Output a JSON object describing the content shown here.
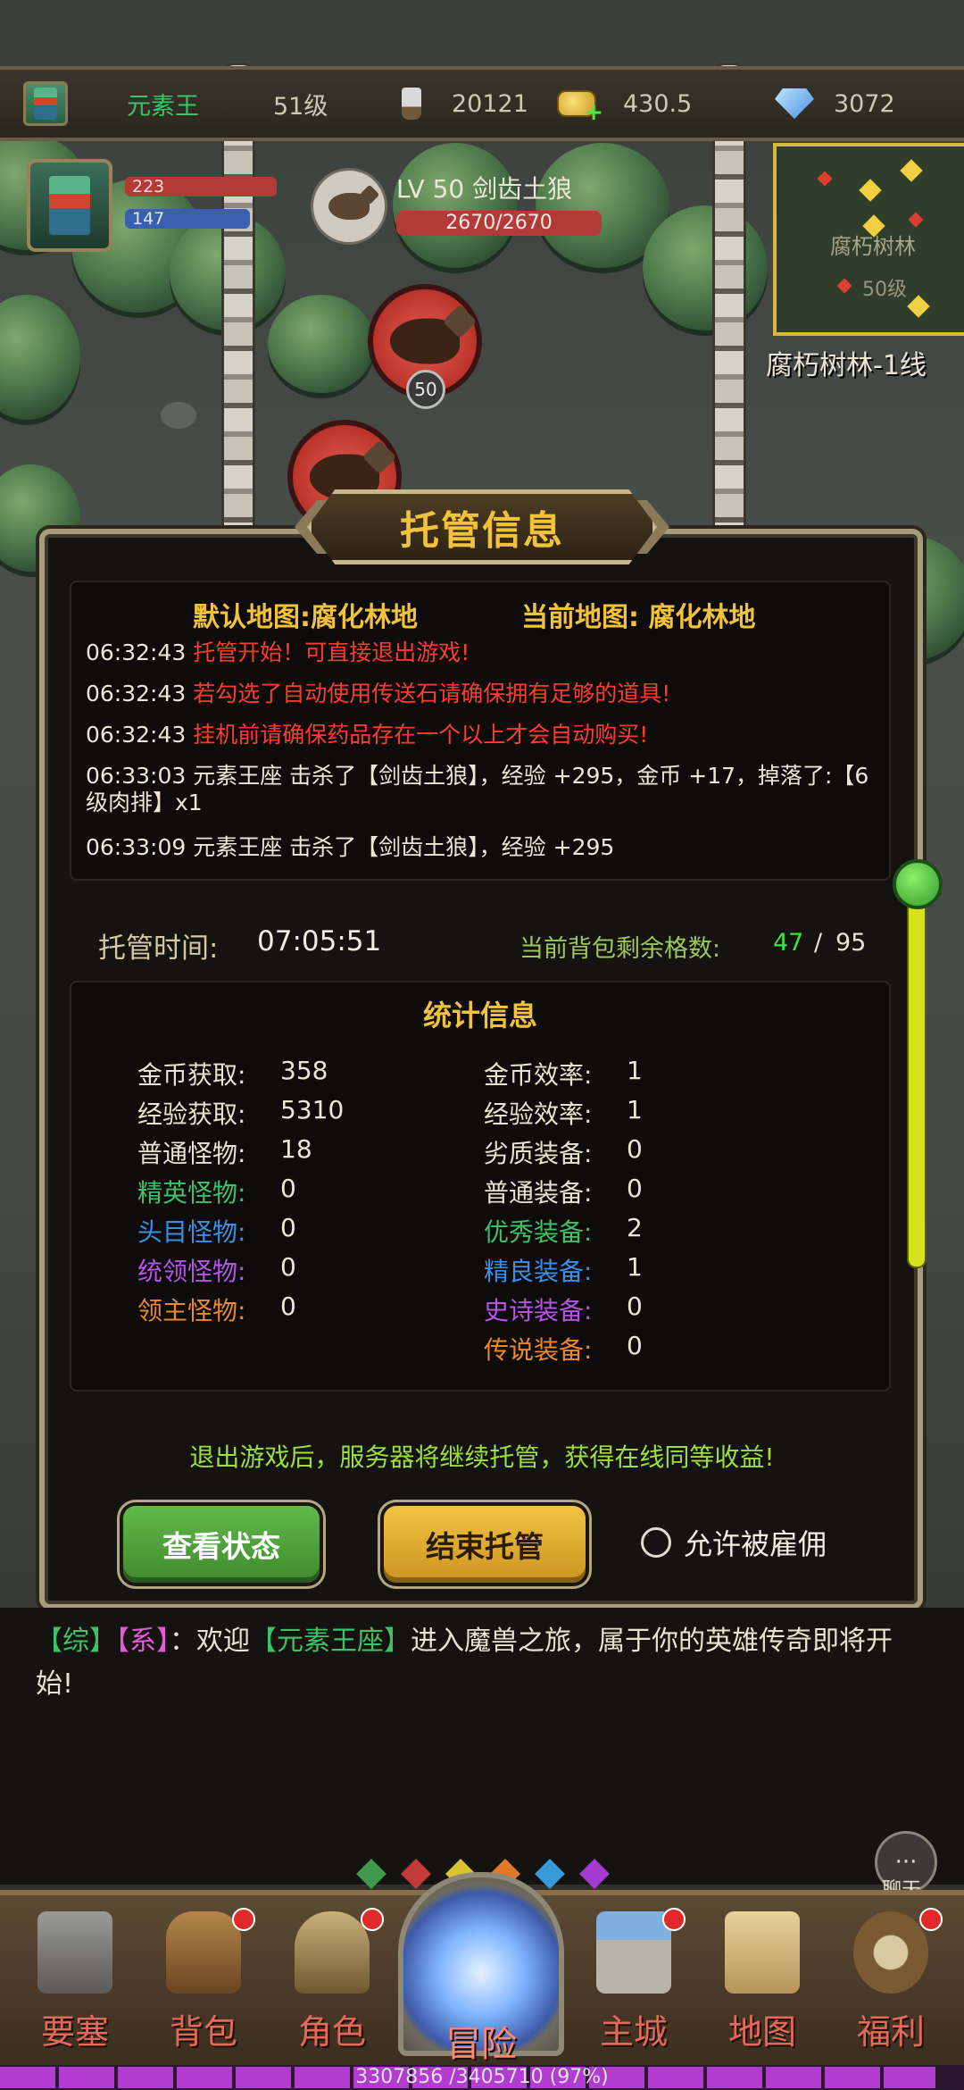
{
  "top_bar": {
    "player_name": "元素王",
    "level": "51级",
    "power": "20121",
    "gold": "430.5",
    "diamonds": "3072"
  },
  "hero": {
    "hp_text": "223",
    "mp_text": "147"
  },
  "target": {
    "name": "LV 50 剑齿土狼",
    "hp": "2670/2670"
  },
  "enemy_level_badge": "50",
  "minimap": {
    "area_name": "腐朽树林",
    "level": "50级",
    "line_label": "腐朽树林-1线"
  },
  "modal": {
    "title": "托管信息",
    "default_map_label": "默认地图:腐化林地",
    "current_map_label": "当前地图: 腐化林地",
    "log": [
      {
        "time": "06:32:43",
        "text": "托管开始！可直接退出游戏!",
        "color": "red"
      },
      {
        "time": "06:32:43",
        "text": "若勾选了自动使用传送石请确保拥有足够的道具!",
        "color": "red"
      },
      {
        "time": "06:32:43",
        "text": "挂机前请确保药品存在一个以上才会自动购买!",
        "color": "red"
      },
      {
        "time": "06:33:03",
        "text": "元素王座 击杀了【剑齿土狼】，经验 +295，金币 +17，掉落了:【6级肉排】x1",
        "color": "white"
      },
      {
        "time": "06:33:09",
        "text": "元素王座 击杀了【剑齿土狼】，经验 +295",
        "color": "white"
      }
    ],
    "hosting_time_label": "托管时间:",
    "hosting_time": "07:05:51",
    "bag_label": "当前背包剩余格数:",
    "bag_current": "47",
    "bag_sep": "/",
    "bag_max": "95",
    "stats_title": "统计信息",
    "stats_left": [
      {
        "label": "金币获取:",
        "value": "358",
        "color": "#e8e2d0"
      },
      {
        "label": "经验获取:",
        "value": "5310",
        "color": "#e8e2d0"
      },
      {
        "label": "普通怪物:",
        "value": "18",
        "color": "#e8e2d0"
      },
      {
        "label": "精英怪物:",
        "value": "0",
        "color": "#3ec267"
      },
      {
        "label": "头目怪物:",
        "value": "0",
        "color": "#3a8fe6"
      },
      {
        "label": "统领怪物:",
        "value": "0",
        "color": "#b454e6"
      },
      {
        "label": "领主怪物:",
        "value": "0",
        "color": "#e88a2a"
      }
    ],
    "stats_right": [
      {
        "label": "金币效率:",
        "value": "1",
        "color": "#e8e2d0"
      },
      {
        "label": "经验效率:",
        "value": "1",
        "color": "#e8e2d0"
      },
      {
        "label": "劣质装备:",
        "value": "0",
        "color": "#e8e2d0"
      },
      {
        "label": "普通装备:",
        "value": "0",
        "color": "#e8e2d0"
      },
      {
        "label": "优秀装备:",
        "value": "2",
        "color": "#3ec267"
      },
      {
        "label": "精良装备:",
        "value": "1",
        "color": "#3a8fe6"
      },
      {
        "label": "史诗装备:",
        "value": "0",
        "color": "#b454e6"
      },
      {
        "label": "传说装备:",
        "value": "0",
        "color": "#e88a2a"
      }
    ],
    "notice": "退出游戏后，服务器将继续托管，获得在线同等收益!",
    "btn_status": "查看状态",
    "btn_stop": "结束托管",
    "allow_hire": "允许被雇佣"
  },
  "chat": {
    "tag_all": "【综】",
    "tag_sys": "【系】",
    "msg_pre": "：欢迎",
    "player": "【元素王座】",
    "msg_post": "进入魔兽之旅，属于你的英雄传奇即将开始!",
    "chat_button_label": "聊天"
  },
  "nav": {
    "items": [
      {
        "label": "要塞",
        "icon": "fortress-icon"
      },
      {
        "label": "背包",
        "icon": "backpack-icon"
      },
      {
        "label": "角色",
        "icon": "helmet-icon"
      },
      {
        "label": "冒险",
        "icon": "portal-icon"
      },
      {
        "label": "主城",
        "icon": "castle-icon"
      },
      {
        "label": "地图",
        "icon": "scroll-map-icon"
      },
      {
        "label": "福利",
        "icon": "gift-bag-icon"
      }
    ],
    "exp_text": "3307856 /3405710 (97%)",
    "exp_fraction": 0.97
  },
  "colors": {
    "gold_text": "#f3c23c",
    "green_text": "#9ede3e",
    "red_text": "#ff3b30"
  }
}
